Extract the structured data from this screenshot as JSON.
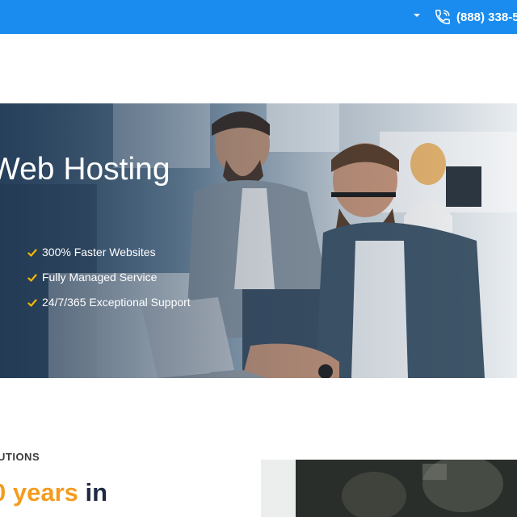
{
  "topbar": {
    "color": "#1a8cf0",
    "dropdown_icon": "caret-down-icon",
    "phone_icon": "phone-icon",
    "phone": "(888) 338-5"
  },
  "hero": {
    "title": "Web Hosting",
    "features": [
      "300% Faster Websites",
      "Fully Managed Service",
      "24/7/365 Exceptional Support"
    ],
    "check_color": "#f5b800"
  },
  "section": {
    "eyebrow": "UTIONS",
    "headline_accent": "0 years",
    "headline_rest": " in",
    "accent_color": "#f39c1f"
  }
}
